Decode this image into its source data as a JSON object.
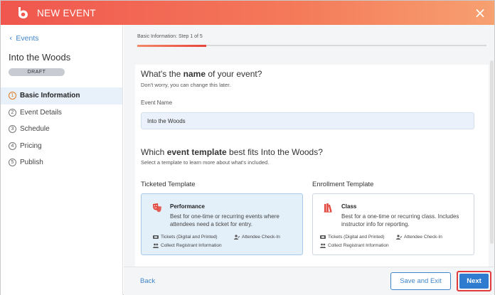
{
  "header": {
    "title": "NEW EVENT",
    "close_symbol": "×"
  },
  "sidebar": {
    "back_label": "Events",
    "event_title": "Into the Woods",
    "status_badge": "DRAFT",
    "steps": [
      {
        "num": "1",
        "label": "Basic Information",
        "active": true
      },
      {
        "num": "2",
        "label": "Event Details",
        "active": false
      },
      {
        "num": "3",
        "label": "Schedule",
        "active": false
      },
      {
        "num": "4",
        "label": "Pricing",
        "active": false
      },
      {
        "num": "5",
        "label": "Publish",
        "active": false
      }
    ]
  },
  "progress": {
    "label": "Basic Information: Step 1 of 5",
    "fraction": 0.2
  },
  "form": {
    "name_question_pre": "What's the ",
    "name_question_bold": "name",
    "name_question_post": " of your event?",
    "name_hint": "Don't worry, you can change this later.",
    "name_field_label": "Event Name",
    "name_value": "Into the Woods",
    "template_question_pre": "Which ",
    "template_question_bold": "event template",
    "template_question_post": " best fits Into the Woods?",
    "template_hint": "Select a template to learn more about what's included."
  },
  "templates": {
    "ticketed": {
      "heading": "Ticketed Template",
      "title": "Performance",
      "description": "Best for one-time or recurring events where attendees need a ticket for entry.",
      "feature_tickets": "Tickets (Digital and Printed)",
      "feature_checkin": "Attendee Check-In",
      "feature_info": "Collect Registrant Information",
      "selected": true
    },
    "enrollment": {
      "heading": "Enrollment Template",
      "title": "Class",
      "description": "Best for a one-time or recurring class. Includes instructor info for reporting.",
      "feature_tickets": "Tickets (Digital and Printed)",
      "feature_checkin": "Attendee Check-In",
      "feature_info": "Collect Registrant Information",
      "selected": false
    }
  },
  "footer": {
    "back_label": "Back",
    "save_label": "Save and Exit",
    "next_label": "Next"
  },
  "colors": {
    "accent": "#2f7bd0",
    "brand": "#f0564e",
    "highlight": "#e23b3b"
  }
}
